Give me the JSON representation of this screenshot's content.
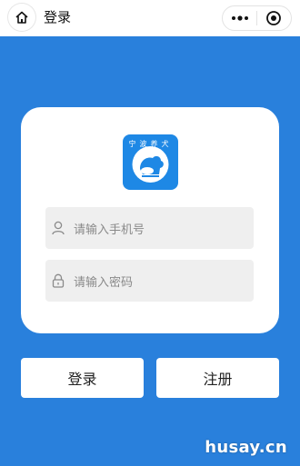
{
  "header": {
    "title": "登录",
    "home_icon": "home-icon",
    "more_icon": "more-dots-icon",
    "close_icon": "target-close-icon"
  },
  "colors": {
    "background": "#2980dc",
    "card": "#ffffff",
    "field": "#efefef",
    "logo": "#1e88e5"
  },
  "logo": {
    "text": "宁波养犬",
    "icon": "dog-logo-icon"
  },
  "form": {
    "phone_placeholder": "请输入手机号",
    "password_placeholder": "请输入密码",
    "phone_icon": "user-icon",
    "password_icon": "lock-icon"
  },
  "buttons": {
    "login_label": "登录",
    "register_label": "注册"
  },
  "watermark": "husay.cn"
}
